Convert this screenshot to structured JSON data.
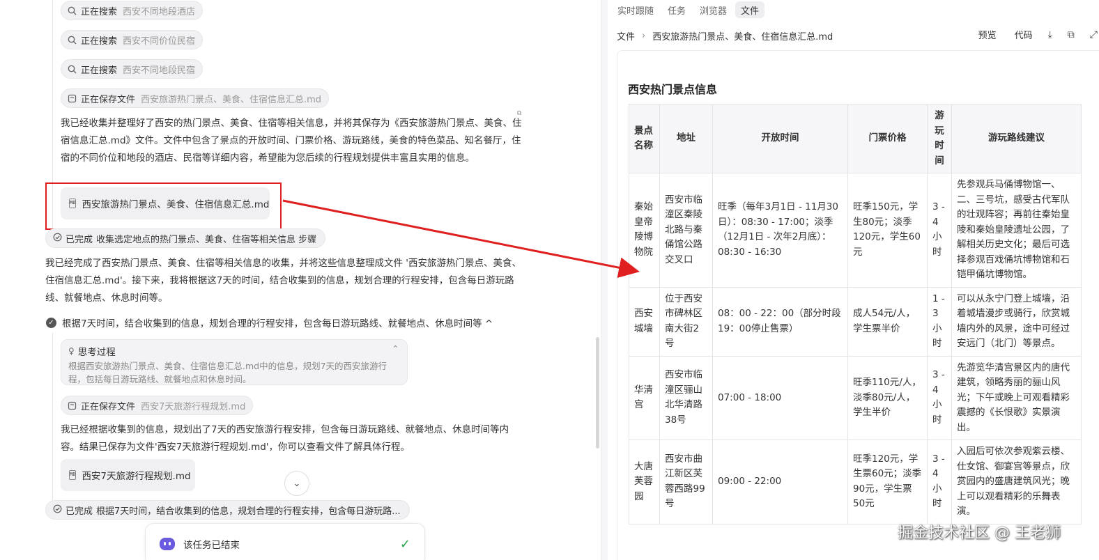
{
  "left_panel": {
    "search_pills": [
      {
        "action": "正在搜索",
        "target": "西安不同地段酒店"
      },
      {
        "action": "正在搜索",
        "target": "西安不同价位民宿"
      },
      {
        "action": "正在搜索",
        "target": "西安不同地段民宿"
      }
    ],
    "save_pill_1": {
      "action": "正在保存文件",
      "target": "西安旅游热门景点、美食、住宿信息汇总.md"
    },
    "message_1": "我已经收集并整理好了西安的热门景点、美食、住宿等相关信息，并将其保存为《西安旅游热门景点、美食、住宿信息汇总.md》文件。文件中包含了景点的开放时间、门票价格、游玩路线，美食的特色菜品、知名餐厅，住宿的不同价位和地段的酒店、民宿等详细内容，希望能为您后续的行程规划提供丰富且实用的信息。",
    "file_card_1": {
      "icon_label": "MD",
      "name": "西安旅游热门景点、美食、住宿信息汇总.md"
    },
    "done_step_1": {
      "status": "已完成",
      "text": "收集选定地点的热门景点、美食、住宿等相关信息 步骤"
    },
    "message_2": "我已经完成了西安热门景点、美食、住宿等相关信息的收集，并将这些信息整理成文件 '西安旅游热门景点、美食、住宿信息汇总.md'。接下来，我将根据这7天的时间，结合收集到的信息，规划合理的行程安排，包含每日游玩路线、就餐地点、休息时间等。",
    "step_2": {
      "text": "根据7天时间，结合收集到的信息，规划合理的行程安排，包含每日游玩路线、就餐地点、休息时间等 ^"
    },
    "thinking": {
      "title": "思考过程",
      "body": "根据西安旅游热门景点、美食、住宿信息汇总.md中的信息，规划7天的西安旅游行程，包括每日游玩路线、就餐地点和休息时间。"
    },
    "save_pill_2": {
      "action": "正在保存文件",
      "target": "西安7天旅游行程规划.md"
    },
    "message_3": "我已经根据收集到的信息，规划出了7天的西安旅游行程安排，包含每日游玩路线、就餐地点、休息时间等内容。结果已保存为文件'西安7天旅游行程规划.md'，你可以查看文件了解具体行程。",
    "file_card_2": {
      "icon_label": "MD",
      "name": "西安7天旅游行程规划.md"
    },
    "done_step_2": {
      "status": "已完成",
      "text": "根据7天时间，结合收集到的信息，规划合理的行程安排，包含每日游玩路..."
    },
    "task_status": "该任务已结束"
  },
  "right_panel": {
    "tabs": [
      "实时跟随",
      "任务",
      "浏览器",
      "文件"
    ],
    "active_tab": "文件",
    "breadcrumb": {
      "root": "文件",
      "file": "西安旅游热门景点、美食、住宿信息汇总.md"
    },
    "toolbar": {
      "preview": "预览",
      "code": "代码"
    },
    "doc": {
      "heading": "西安热门景点信息",
      "table": {
        "headers": [
          "景点名称",
          "地址",
          "开放时间",
          "门票价格",
          "游玩时间",
          "游玩路线建议"
        ],
        "rows": [
          [
            "秦始皇帝陵博物院",
            "西安市临潼区秦陵北路与秦俑馆公路交叉口",
            "旺季（每年3月1日 - 11月30日）：08:30 - 17:00；淡季（12月1日 - 次年2月底）：08:30 - 16:30",
            "旺季150元，学生80元；淡季120元，学生60元",
            "3 - 4 小时",
            "先参观兵马俑博物馆一、二、三号坑，感受古代军队的壮观阵容；再前往秦始皇陵和秦始皇陵遗址公园，了解相关历史文化；最后可选择参观百戏俑坑博物馆和石铠甲俑坑博物馆。"
          ],
          [
            "西安城墙",
            "位于西安市碑林区南大街2号",
            "08：00 - 22：00（部分时段19：00停止售票）",
            "成人54元/人，学生票半价",
            "1 - 3 小时",
            "可以从永宁门登上城墙，沿着城墙漫步或骑行，欣赏城墙内外的风景，途中可经过安远门（北门）等景点。"
          ],
          [
            "华清宫",
            "西安市临潼区骊山北华清路38号",
            "07:00 - 18:00",
            "旺季110元/人，淡季80元/人，学生半价",
            "3 - 4 小时",
            "先游览华清宫景区内的唐代建筑，领略秀丽的骊山风光；下午或晚上可观看精彩震撼的《长恨歌》实景演出。"
          ],
          [
            "大唐芙蓉园",
            "西安市曲江新区芙蓉西路99号",
            "09:00 - 22:00",
            "旺季120元，学生票60元；淡季90元，学生票50元",
            "3 - 4 小时",
            "入园后可依次参观紫云楼、仕女馆、御宴宫等景点，欣赏园内的盛唐建筑风光；晚上可以观看精彩的乐舞表演。"
          ]
        ]
      }
    }
  },
  "watermark": "掘金技术社区 @ 王老狮",
  "colors": {
    "highlight_box": "#e02020",
    "arrow": "#e02020",
    "done_check": "#22a447",
    "bot_avatar": "#6a5ae0"
  }
}
